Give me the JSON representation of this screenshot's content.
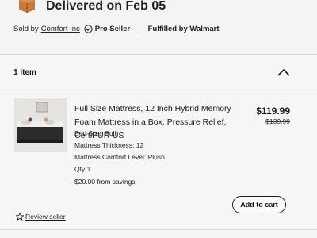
{
  "header": {
    "delivered_text": "Delivered on Feb 05",
    "sold_by_prefix": "Sold by",
    "seller_name": "Comfort Inc",
    "pro_seller": "Pro Seller",
    "separator": "|",
    "fulfilled_by": "Fulfilled by Walmart",
    "package_icon": "package-icon",
    "badge_icon": "verified-check-icon"
  },
  "items_section": {
    "count_label": "1 item",
    "collapse_icon": "chevron-up-icon"
  },
  "item": {
    "title": "Full Size Mattress, 12 Inch Hybrid Memory Foam Mattress in a Box, Pressure Relief, CertiPUR-US",
    "attributes": [
      "Bed Size: Full",
      "Mattress Thickness: 12",
      "Mattress Comfort Level: Plush",
      "Qty 1"
    ],
    "savings": "$20.00 from savings",
    "price": "$119.99",
    "was_price": "$139.99"
  },
  "actions": {
    "add_to_cart": "Add to cart",
    "review_seller": "Review seller",
    "review_icon": "star-outline-icon"
  },
  "colors": {
    "background": "#f2f2f2",
    "text": "#1a1a1a",
    "package_box": "#c0703a"
  }
}
